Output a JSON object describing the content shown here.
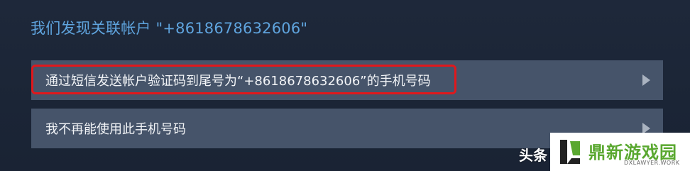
{
  "dialog": {
    "heading": "我们发现关联帐户 \"+8618678632606\""
  },
  "options": [
    {
      "label": "通过短信发送帐户验证码到尾号为“+8618678632606”的手机号码",
      "icon": "chevron-right-icon"
    },
    {
      "label": "我不再能使用此手机号码",
      "icon": "chevron-right-icon"
    }
  ],
  "watermark": {
    "text": "头条",
    "logo_title": "鼎新游戏园",
    "logo_sub": "DXLAWYER.WORK"
  },
  "colors": {
    "background": "#1c2638",
    "heading": "#5fa4de",
    "option_bg": "#46546a",
    "highlight": "#e0181c",
    "logo_green": "#5aa830"
  }
}
